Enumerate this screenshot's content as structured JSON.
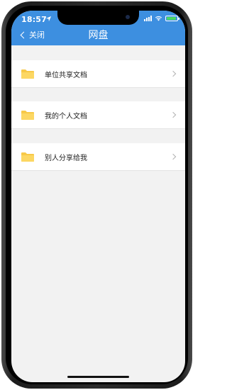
{
  "status_bar": {
    "time": "18:57",
    "battery_color": "#4cd964"
  },
  "header": {
    "back_label": "关闭",
    "title": "网盘",
    "background_color": "#3d8fe0"
  },
  "folders": [
    {
      "label": "单位共享文档",
      "icon": "folder-icon"
    },
    {
      "label": "我的个人文档",
      "icon": "folder-icon"
    },
    {
      "label": "别人分享给我",
      "icon": "folder-icon"
    }
  ]
}
